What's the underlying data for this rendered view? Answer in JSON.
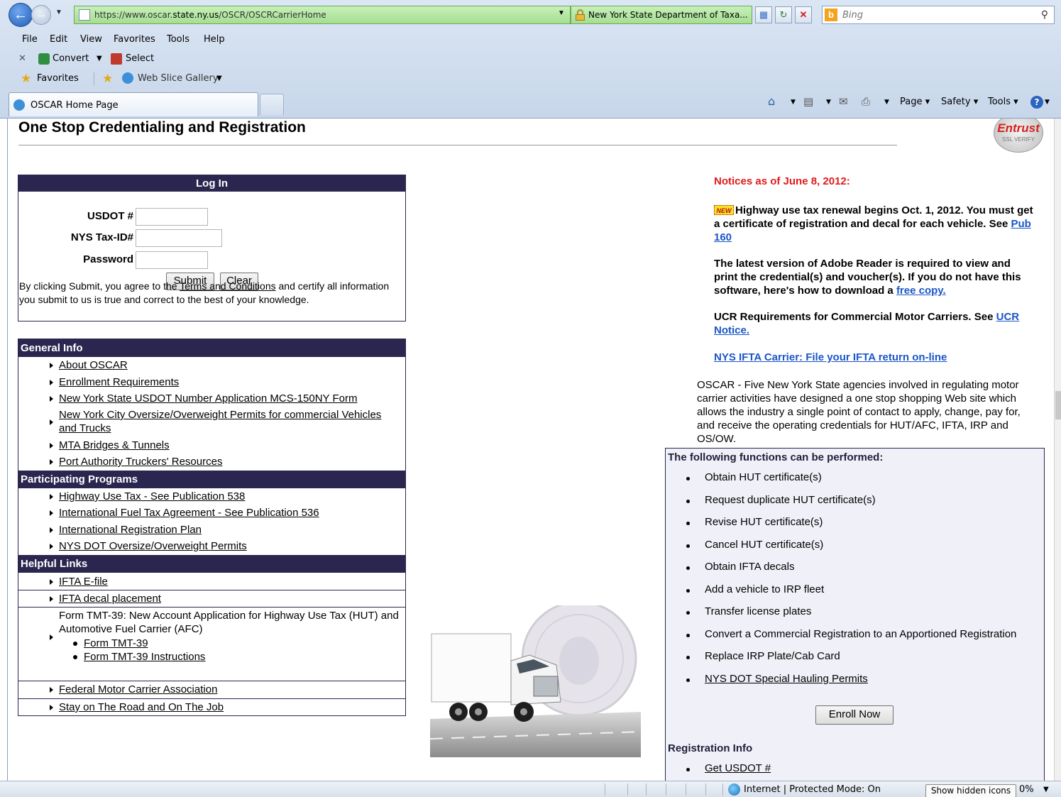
{
  "browser": {
    "url_prefix": "https://www.oscar.",
    "url_domain": "state.ny.us",
    "url_path": "/OSCR/OSCRCarrierHome",
    "cert_text": "New York State Department of Taxa...",
    "search_placeholder": "Bing",
    "menu": [
      "File",
      "Edit",
      "View",
      "Favorites",
      "Tools",
      "Help"
    ],
    "cmd_convert": "Convert",
    "cmd_select": "Select",
    "favorites_label": "Favorites",
    "web_slice_label": "Web Slice Gallery",
    "tab_title": "OSCAR Home Page",
    "toolbar_page": "Page ▾",
    "toolbar_safety": "Safety ▾",
    "toolbar_tools": "Tools ▾",
    "status_zone": "Internet | Protected Mode: On",
    "status_hidden_icons": "Show hidden icons",
    "status_zoom": "0%"
  },
  "page": {
    "title": "One Stop Credentialing and Registration",
    "entrust_wordmark": "Entrust",
    "entrust_sub": "SSL VERIFY"
  },
  "login": {
    "heading": "Log In",
    "usdot_label": "USDOT #",
    "taxid_label": "NYS Tax-ID#",
    "password_label": "Password",
    "submit_label": "Submit",
    "clear_label": "Clear",
    "note_before": "By clicking Submit, you agree to the ",
    "note_link": "Terms and Conditions",
    "note_after": " and certify all information you submit to us is true and correct to the best of your knowledge."
  },
  "nav": {
    "general_info": "General Info",
    "general_items": [
      "About OSCAR",
      "Enrollment Requirements",
      "New York State USDOT Number Application MCS-150NY Form",
      "New York City Oversize/Overweight Permits for commercial Vehicles and Trucks",
      "MTA Bridges & Tunnels",
      "Port Authority Truckers' Resources"
    ],
    "participating_programs": "Participating Programs",
    "program_items": [
      "Highway Use Tax - See Publication 538",
      "International Fuel Tax Agreement - See Publication 536",
      "International Registration Plan",
      "NYS DOT Oversize/Overweight Permits"
    ],
    "helpful_links": "Helpful Links",
    "helpful_items": [
      "IFTA E-file",
      "IFTA decal placement"
    ],
    "tmt_text": "Form TMT-39: New Account Application for Highway Use Tax (HUT) and Automotive Fuel Carrier (AFC)",
    "tmt_links": [
      "Form TMT-39",
      "Form TMT-39 Instructions"
    ],
    "helpful_items_2": [
      "Federal Motor Carrier Association",
      "Stay on The Road and On The Job"
    ]
  },
  "notices": {
    "title": "Notices as of June 8, 2012:",
    "new_badge": "NEW",
    "n1_text": "Highway use tax renewal begins Oct. 1, 2012. You must get a certificate of registration and decal for each vehicle. See ",
    "n1_link": "Pub 160",
    "n2_text": "The latest version of Adobe Reader is required to view and print the credential(s) and voucher(s). If you do not have this software, here's how to download a ",
    "n2_link": "free copy.",
    "n3_text": "UCR Requirements for Commercial Motor Carriers. See ",
    "n3_link": "UCR Notice.",
    "n4_link": "NYS IFTA Carrier: File your IFTA return on-line"
  },
  "oscar_desc": "OSCAR - Five New York State agencies involved in regulating motor carrier activities have designed a one stop shopping Web site which allows the industry a single point of contact to apply, change, pay for, and receive the operating credentials for HUT/AFC, IFTA, IRP and OS/OW.",
  "functions": {
    "heading": "The following functions can be performed:",
    "items": [
      "Obtain HUT certificate(s)",
      "Request duplicate HUT certificate(s)",
      "Revise HUT certificate(s)",
      "Cancel HUT certificate(s)",
      "Obtain IFTA decals",
      "Add a vehicle to IRP fleet",
      "Transfer license plates",
      "Convert a Commercial Registration to an Apportioned Registration",
      "Replace IRP Plate/Cab Card"
    ],
    "link_item": "NYS DOT Special Hauling Permits",
    "enroll_label": "Enroll Now",
    "reg_heading": "Registration Info",
    "reg_items": [
      "Get USDOT #"
    ]
  }
}
